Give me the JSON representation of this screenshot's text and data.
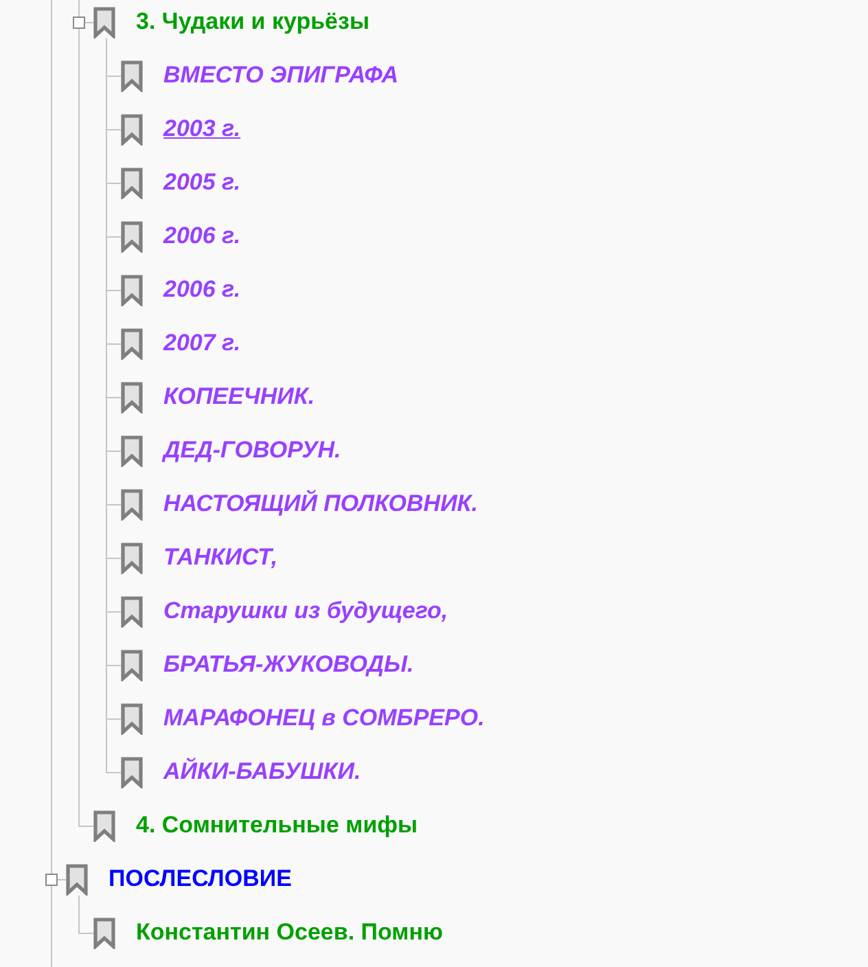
{
  "bookmarks": [
    {
      "children": [
        {
          "title": "3. Чудаки и курьёзы",
          "color": "#00a000",
          "italic": false,
          "hovered": false,
          "expanded": true,
          "children": [
            {
              "title": "ВМЕСТО ЭПИГРАФА",
              "color": "#9940ff",
              "italic": true,
              "hovered": false
            },
            {
              "title": "2003 г.",
              "color": "#9940ff",
              "italic": true,
              "hovered": true
            },
            {
              "title": "2005 г.",
              "color": "#9940ff",
              "italic": true,
              "hovered": false
            },
            {
              "title": "2006 г.",
              "color": "#9940ff",
              "italic": true,
              "hovered": false
            },
            {
              "title": "2006 г.",
              "color": "#9940ff",
              "italic": true,
              "hovered": false
            },
            {
              "title": "2007 г.",
              "color": "#9940ff",
              "italic": true,
              "hovered": false
            },
            {
              "title": "КОПЕЕЧНИК.",
              "color": "#9940ff",
              "italic": true,
              "hovered": false
            },
            {
              "title": "ДЕД-ГОВОРУН.",
              "color": "#9940ff",
              "italic": true,
              "hovered": false
            },
            {
              "title": "НАСТОЯЩИЙ ПОЛКОВНИК.",
              "color": "#9940ff",
              "italic": true,
              "hovered": false
            },
            {
              "title": "ТАНКИСТ,",
              "color": "#9940ff",
              "italic": true,
              "hovered": false
            },
            {
              "title": "Старушки из будущего,",
              "color": "#9940ff",
              "italic": true,
              "hovered": false
            },
            {
              "title": "БРАТЬЯ-ЖУКОВОДЫ.",
              "color": "#9940ff",
              "italic": true,
              "hovered": false
            },
            {
              "title": "МАРАФОНЕЦ в СОМБРЕРО.",
              "color": "#9940ff",
              "italic": true,
              "hovered": false
            },
            {
              "title": "АЙКИ-БАБУШКИ.",
              "color": "#9940ff",
              "italic": true,
              "hovered": false
            }
          ]
        },
        {
          "title": "4. Сомнительные мифы",
          "color": "#00a000",
          "italic": false,
          "hovered": false
        }
      ]
    },
    {
      "title": "ПОСЛЕСЛОВИЕ",
      "color": "#0000ff",
      "italic": false,
      "hovered": false,
      "expanded": true,
      "children": [
        {
          "title": "Константин Осеев. Помню",
          "color": "#00a000",
          "italic": false,
          "hovered": false
        }
      ]
    }
  ]
}
